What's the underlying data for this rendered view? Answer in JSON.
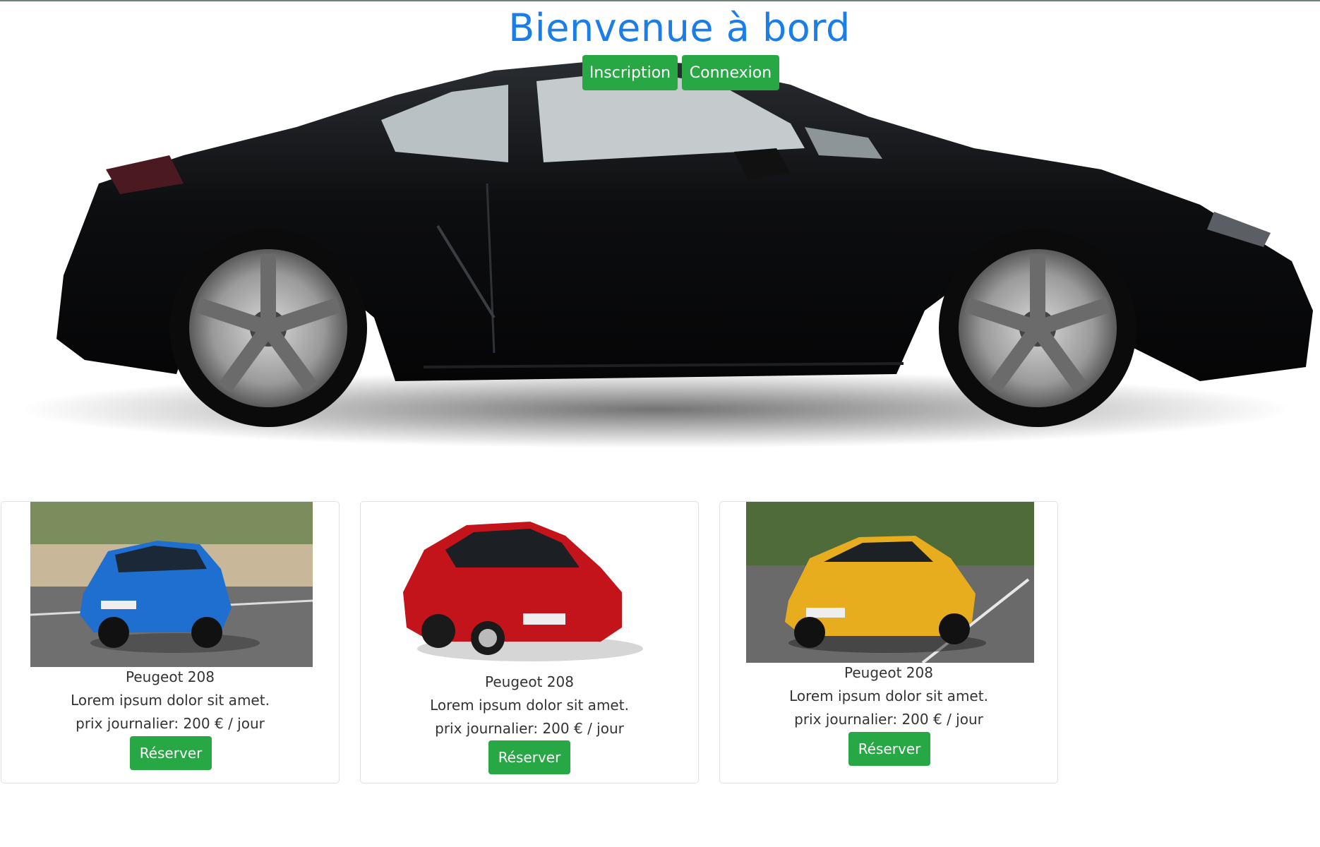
{
  "header": {
    "title": "Bienvenue à bord",
    "inscription_label": "Inscription",
    "connexion_label": "Connexion"
  },
  "cards": [
    {
      "name": "Peugeot 208",
      "description": "Lorem ipsum dolor sit amet.",
      "price": "prix journalier: 200 € / jour",
      "button": "Réserver"
    },
    {
      "name": "Peugeot 208",
      "description": "Lorem ipsum dolor sit amet.",
      "price": "prix journalier: 200 € / jour",
      "button": "Réserver"
    },
    {
      "name": "Peugeot 208",
      "description": "Lorem ipsum dolor sit amet.",
      "price": "prix journalier: 200 € / jour",
      "button": "Réserver"
    }
  ],
  "colors": {
    "title": "#1a7de8",
    "button": "#28a745",
    "card_border": "#dfe2e5"
  }
}
